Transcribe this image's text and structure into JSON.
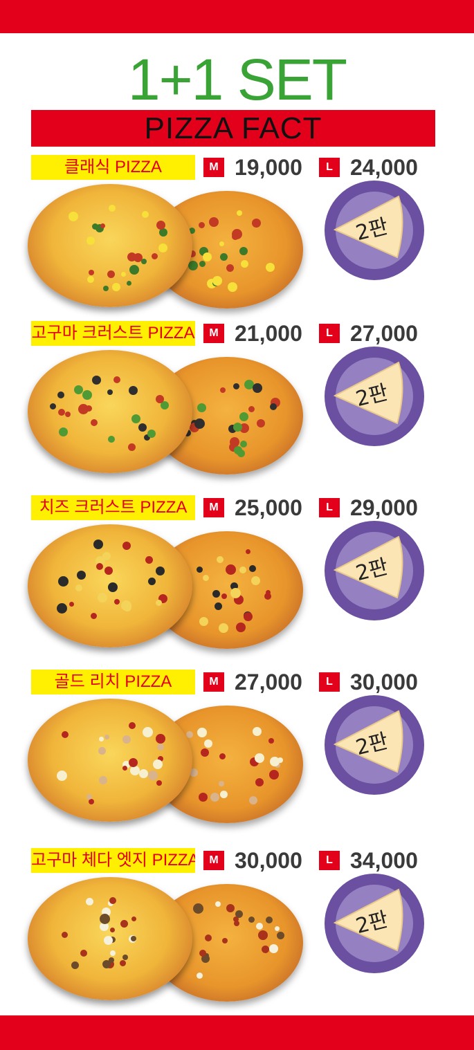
{
  "header": {
    "title": "1+1 SET",
    "subtitle": "PIZZA FACT"
  },
  "size_labels": {
    "medium": "M",
    "large": "L"
  },
  "badge_text": "2판",
  "colors": {
    "brand_red": "#e3001b",
    "title_green": "#3aa335",
    "tag_yellow": "#ffef00",
    "badge_purple": "#6b4fa0"
  },
  "menu": [
    {
      "name": "클래식 PIZZA",
      "price_m": "19,000",
      "price_l": "24,000"
    },
    {
      "name": "고구마 크러스트 PIZZA",
      "price_m": "21,000",
      "price_l": "27,000"
    },
    {
      "name": "치즈 크러스트 PIZZA",
      "price_m": "25,000",
      "price_l": "29,000"
    },
    {
      "name": "골드 리치 PIZZA",
      "price_m": "27,000",
      "price_l": "30,000"
    },
    {
      "name": "고구마 체다 엣지 PIZZA",
      "price_m": "30,000",
      "price_l": "34,000"
    }
  ]
}
